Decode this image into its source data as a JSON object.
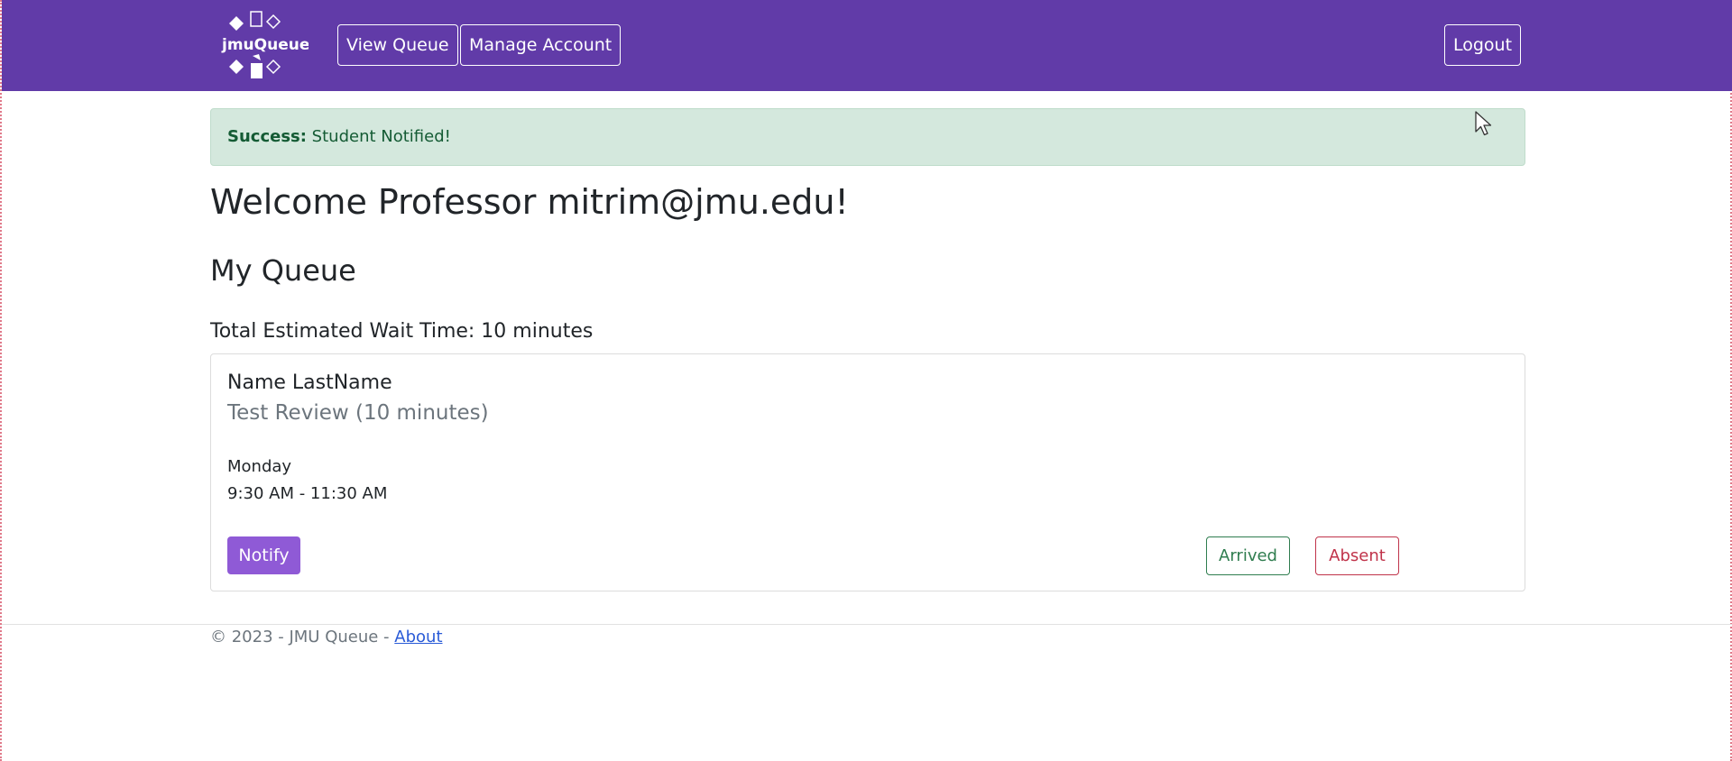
{
  "navbar": {
    "logo_text": "jmuQueue",
    "view_queue_label": "View Queue",
    "manage_account_label": "Manage Account",
    "logout_label": "Logout",
    "background_color": "#613ba8"
  },
  "alert": {
    "label": "Success:",
    "message": " Student Notified!"
  },
  "page": {
    "welcome_title": "Welcome Professor mitrim@jmu.edu!",
    "queue_heading": "My Queue",
    "total_wait": "Total Estimated Wait Time: 10 minutes"
  },
  "queue_entries": [
    {
      "student_name": "Name LastName",
      "reason": "Test Review (10 minutes)",
      "day": "Monday",
      "time_range": "9:30 AM - 11:30 AM",
      "notify_label": "Notify",
      "arrived_label": "Arrived",
      "absent_label": "Absent"
    }
  ],
  "footer": {
    "copyright": "© 2023 - JMU Queue - ",
    "about_link": "About"
  },
  "colors": {
    "accent": "#8f5ad6",
    "success_text": "#145b34",
    "success_bg": "#d4e8dd",
    "arrived": "#2f7d4f",
    "absent": "#c0334a"
  }
}
